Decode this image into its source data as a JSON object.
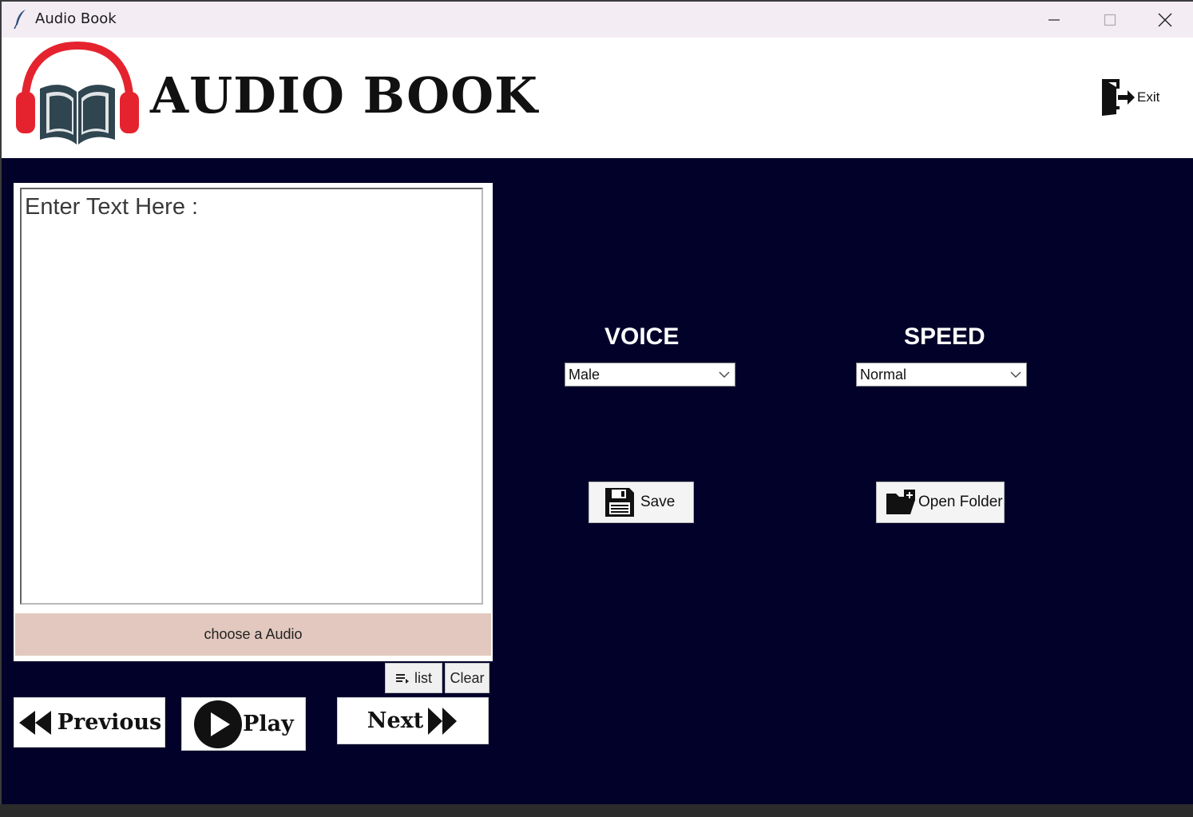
{
  "window": {
    "title": "Audio Book"
  },
  "header": {
    "brand": "AUDIO BOOK",
    "exit_label": "Exit"
  },
  "editor": {
    "placeholder": "Enter Text Here :"
  },
  "choose_audio_label": "choose a Audio",
  "list_button_label": "list",
  "clear_button_label": "Clear",
  "nav": {
    "previous_label": "Previous",
    "play_label": "Play",
    "next_label": "Next"
  },
  "voice": {
    "label": "VOICE",
    "selected": "Male"
  },
  "speed": {
    "label": "SPEED",
    "selected": "Normal"
  },
  "actions": {
    "save_label": "Save",
    "open_folder_label": "Open Folder"
  },
  "colors": {
    "background": "#01012a",
    "choose_audio_bg": "#e2c8be",
    "logo_red": "#e5232f",
    "logo_slate": "#2f4550"
  },
  "icons": [
    "feather-icon",
    "minimize-icon",
    "maximize-icon",
    "close-icon",
    "headphones-book-logo",
    "exit-door-icon",
    "list-icon",
    "rewind-icon",
    "play-icon",
    "fast-forward-icon",
    "chevron-down-icon",
    "floppy-save-icon",
    "add-folder-icon"
  ]
}
